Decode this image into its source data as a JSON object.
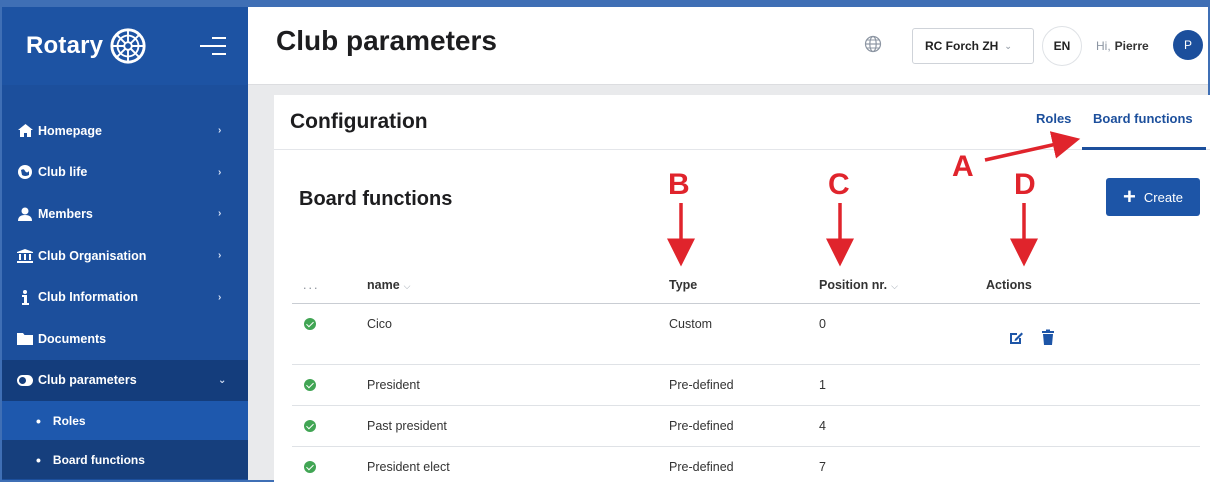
{
  "brand": {
    "logo_text": "Rotary"
  },
  "sidebar": {
    "items": [
      {
        "label": "Homepage",
        "icon": "home-icon",
        "chevron": "›"
      },
      {
        "label": "Club life",
        "icon": "globe-icon",
        "chevron": "›"
      },
      {
        "label": "Members",
        "icon": "user-icon",
        "chevron": "›"
      },
      {
        "label": "Club Organisation",
        "icon": "institution-icon",
        "chevron": "›"
      },
      {
        "label": "Club Information",
        "icon": "info-icon",
        "chevron": "›"
      },
      {
        "label": "Documents",
        "icon": "folder-icon",
        "chevron": ""
      },
      {
        "label": "Club parameters",
        "icon": "toggle-icon",
        "chevron": "⌄"
      }
    ],
    "subitems": [
      {
        "label": "Roles",
        "bullet": "•"
      },
      {
        "label": "Board functions",
        "bullet": "•"
      }
    ]
  },
  "header": {
    "title": "Club parameters",
    "club_select": "RC Forch ZH",
    "club_caret": "⌄",
    "language": "EN",
    "greeting_prefix": "Hi,",
    "user_name": "Pierre",
    "avatar_initial": "P"
  },
  "card": {
    "title": "Configuration",
    "tabs": [
      "Roles",
      "Board functions"
    ],
    "active_tab": "Board functions"
  },
  "section": {
    "title": "Board functions",
    "create_label": "Create",
    "create_plus": "+"
  },
  "table": {
    "columns": {
      "dots": "...",
      "name": "name",
      "type": "Type",
      "position": "Position nr.",
      "actions": "Actions"
    },
    "rows": [
      {
        "name": "Cico",
        "type": "Custom",
        "position": "0",
        "has_actions": true
      },
      {
        "name": "President",
        "type": "Pre-defined",
        "position": "1",
        "has_actions": false
      },
      {
        "name": "Past president",
        "type": "Pre-defined",
        "position": "4",
        "has_actions": false
      },
      {
        "name": "President elect",
        "type": "Pre-defined",
        "position": "7",
        "has_actions": false
      }
    ]
  },
  "annotations": {
    "a": "A",
    "b": "B",
    "c": "C",
    "d": "D"
  },
  "colors": {
    "sidebar": "#1c4f9c",
    "sidebar_active": "#143d7c",
    "accent": "#1d55a7",
    "status_ok": "#41a554",
    "annotation": "#e0242c"
  }
}
